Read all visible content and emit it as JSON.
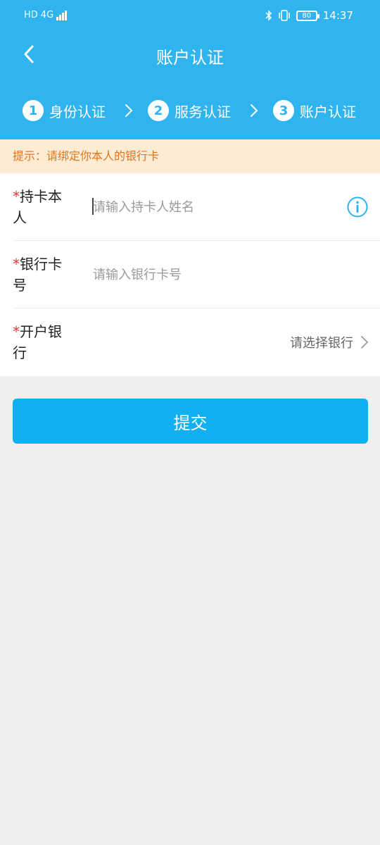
{
  "statusbar": {
    "left_icons": [
      "HD",
      "4G",
      "signal"
    ],
    "time": "14:37",
    "battery": "80"
  },
  "nav": {
    "title": "账户认证"
  },
  "steps": [
    {
      "num": "1",
      "label": "身份认证"
    },
    {
      "num": "2",
      "label": "服务认证"
    },
    {
      "num": "3",
      "label": "账户认证"
    }
  ],
  "tip": {
    "text": "提示：请绑定你本人的银行卡"
  },
  "form": {
    "holder": {
      "required": "*",
      "label": "持卡本人",
      "placeholder": "请输入持卡人姓名"
    },
    "card": {
      "required": "*",
      "label": "银行卡号",
      "placeholder": "请输入银行卡号"
    },
    "bank": {
      "required": "*",
      "label": "开户银行",
      "select_text": "请选择银行"
    }
  },
  "submit": {
    "label": "提交"
  },
  "colors": {
    "header": "#2fb4f0",
    "button": "#12b0f2",
    "tip_bg": "#fdecd4",
    "tip_text": "#e8741c",
    "required": "#e53935"
  }
}
